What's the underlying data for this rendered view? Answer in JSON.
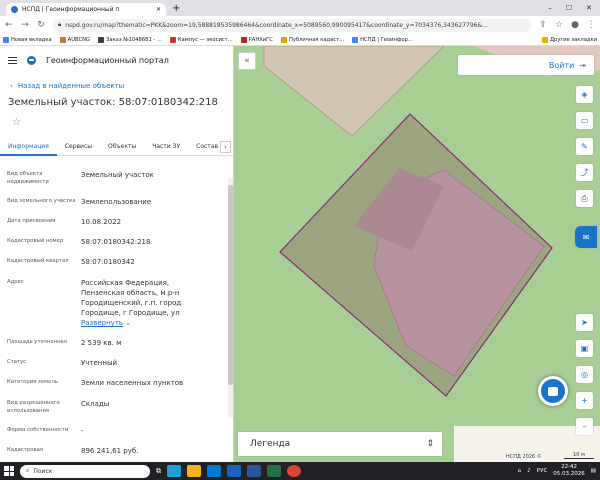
{
  "browser": {
    "tab_title": "НСПД | Геоинформационный п",
    "url": "nspd.gov.ru/map?thematic=PKK&zoom=19,588819535986464&coordinate_x=5089560,990095417&coordinate_y=7034376,343627796&...",
    "bookmarks": [
      "Новая вкладка",
      "AUBCNG",
      "Заказ №1048681 - ...",
      "Кампус — экосист...",
      "РАНХиГС",
      "Публичная кадаст...",
      "НСПД | Геоинфор..."
    ],
    "other_bookmarks": "Другие закладки"
  },
  "portal": {
    "title": "Геоинформационный портал"
  },
  "panel": {
    "back_link": "Назад в найденные объекты",
    "heading": "Земельный участок: 58:07:0180342:218",
    "tabs": [
      "Информация",
      "Сервисы",
      "Объекты",
      "Части ЗУ",
      "Состав"
    ],
    "rows": [
      {
        "key": "Вид объекта недвижимости",
        "value": "Земельный участок"
      },
      {
        "key": "Вид земельного участка",
        "value": "Землепользование"
      },
      {
        "key": "Дата присвоения",
        "value": "10.08.2022"
      },
      {
        "key": "Кадастровый номер",
        "value": "58:07:0180342:218"
      },
      {
        "key": "Кадастровый квартал",
        "value": "58:07:0180342"
      },
      {
        "key": "Адрес",
        "value": "Российская Федерация, Пензенская область, м.р-н Городищенский, г.п. город Городище, г Городище, ул",
        "link": "Развернуть"
      },
      {
        "key": "Площадь уточненная",
        "value": "2 539 кв. м"
      },
      {
        "key": "Статус",
        "value": "Учтенный"
      },
      {
        "key": "Категория земель",
        "value": "Земли населенных пунктов"
      },
      {
        "key": "Вид разрешенного использования",
        "value": "Склады"
      },
      {
        "key": "Форма собственности",
        "value": "-"
      },
      {
        "key": "Кадастровая",
        "value": "896 241,61 руб."
      }
    ]
  },
  "map": {
    "login_label": "Войти",
    "legend_label": "Легенда",
    "copyright": "НСПД 2026 ©",
    "scale": "10 м"
  },
  "taskbar": {
    "search_placeholder": "Поиск",
    "lang": "РУС",
    "time": "22:42",
    "date": "05.03.2026"
  }
}
